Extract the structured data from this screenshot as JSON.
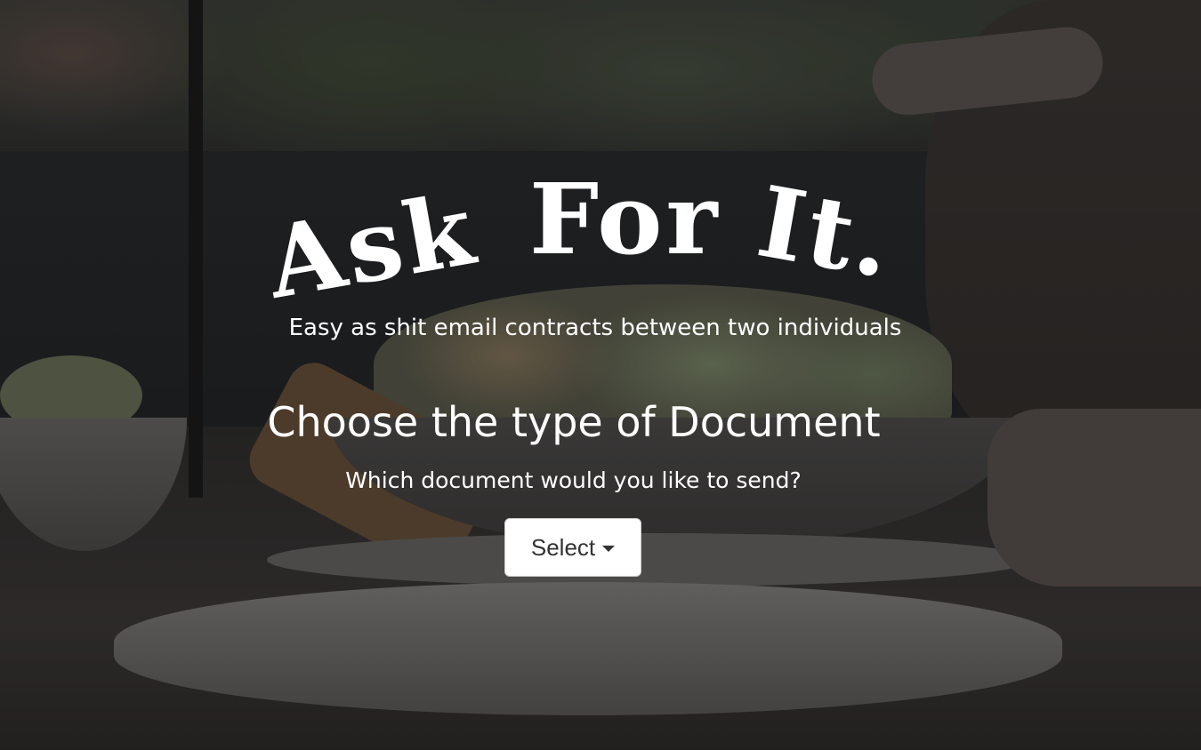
{
  "brand": {
    "logo_text": "Ask For It.",
    "logo_words": [
      "Ask",
      "For",
      "It."
    ],
    "tagline": "Easy as shit email contracts between two individuals"
  },
  "main": {
    "heading": "Choose the type of Document",
    "prompt": "Which document would you like to send?",
    "dropdown": {
      "label": "Select",
      "icon": "caret-down-icon"
    }
  },
  "colors": {
    "text": "#ffffff",
    "button_background": "#ffffff",
    "button_text": "#333333"
  }
}
